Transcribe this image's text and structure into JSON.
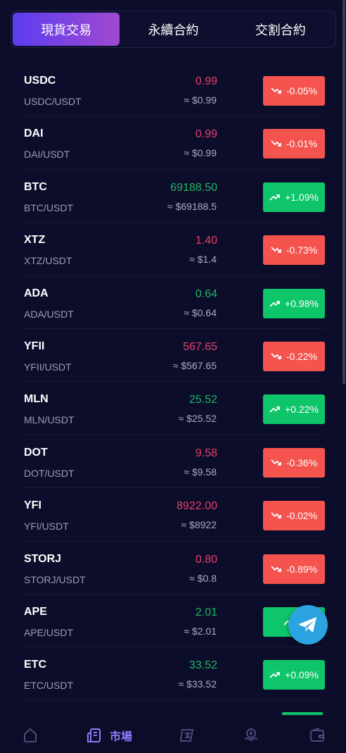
{
  "tabs": [
    {
      "label": "現貨交易",
      "active": true
    },
    {
      "label": "永續合約",
      "active": false
    },
    {
      "label": "交割合約",
      "active": false
    }
  ],
  "markets": [
    {
      "symbol": "USDC",
      "pair": "USDC/USDT",
      "price": "0.99",
      "usd": "≈ $0.99",
      "change": "-0.05%",
      "direction": "down"
    },
    {
      "symbol": "DAI",
      "pair": "DAI/USDT",
      "price": "0.99",
      "usd": "≈ $0.99",
      "change": "-0.01%",
      "direction": "down"
    },
    {
      "symbol": "BTC",
      "pair": "BTC/USDT",
      "price": "69188.50",
      "usd": "≈ $69188.5",
      "change": "+1.09%",
      "direction": "up"
    },
    {
      "symbol": "XTZ",
      "pair": "XTZ/USDT",
      "price": "1.40",
      "usd": "≈ $1.4",
      "change": "-0.73%",
      "direction": "down"
    },
    {
      "symbol": "ADA",
      "pair": "ADA/USDT",
      "price": "0.64",
      "usd": "≈ $0.64",
      "change": "+0.98%",
      "direction": "up"
    },
    {
      "symbol": "YFII",
      "pair": "YFII/USDT",
      "price": "567.65",
      "usd": "≈ $567.65",
      "change": "-0.22%",
      "direction": "down"
    },
    {
      "symbol": "MLN",
      "pair": "MLN/USDT",
      "price": "25.52",
      "usd": "≈ $25.52",
      "change": "+0.22%",
      "direction": "up"
    },
    {
      "symbol": "DOT",
      "pair": "DOT/USDT",
      "price": "9.58",
      "usd": "≈ $9.58",
      "change": "-0.36%",
      "direction": "down"
    },
    {
      "symbol": "YFI",
      "pair": "YFI/USDT",
      "price": "8922.00",
      "usd": "≈ $8922",
      "change": "-0.02%",
      "direction": "down"
    },
    {
      "symbol": "STORJ",
      "pair": "STORJ/USDT",
      "price": "0.80",
      "usd": "≈ $0.8",
      "change": "-0.89%",
      "direction": "down"
    },
    {
      "symbol": "APE",
      "pair": "APE/USDT",
      "price": "2.01",
      "usd": "≈ $2.01",
      "change": "+",
      "direction": "up"
    },
    {
      "symbol": "ETC",
      "pair": "ETC/USDT",
      "price": "33.52",
      "usd": "≈ $33.52",
      "change": "+0.09%",
      "direction": "up"
    }
  ],
  "nav": {
    "items": [
      {
        "name": "home",
        "icon": "home-icon",
        "label": ""
      },
      {
        "name": "market",
        "icon": "market-icon",
        "label": "市場",
        "active": true
      },
      {
        "name": "trade",
        "icon": "trade-icon",
        "label": ""
      },
      {
        "name": "finance",
        "icon": "finance-icon",
        "label": ""
      },
      {
        "name": "wallet",
        "icon": "wallet-icon",
        "label": ""
      }
    ]
  },
  "colors": {
    "background": "#0c0d2a",
    "up": "#1fb863",
    "down": "#e6406a",
    "up_badge": "#0fc56a",
    "down_badge": "#f4534e",
    "accent": "#8f7bff",
    "telegram": "#2aa3e0"
  }
}
